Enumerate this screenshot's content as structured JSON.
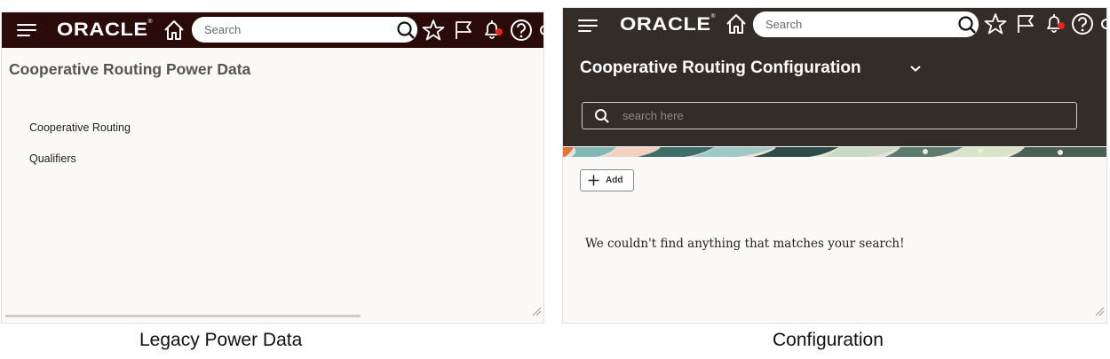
{
  "left_panel": {
    "topbar": {
      "logo_text": "ORACLE",
      "logo_mark": "®",
      "search_placeholder": "Search",
      "icons": [
        "hamburger-menu-icon",
        "home-icon",
        "search-icon",
        "star-icon",
        "flag-icon",
        "bell-icon",
        "help-icon"
      ]
    },
    "page_title": "Cooperative Routing Power Data",
    "nav_items": [
      {
        "label": "Cooperative Routing"
      },
      {
        "label": "Qualifiers"
      }
    ]
  },
  "right_panel": {
    "topbar": {
      "logo_text": "ORACLE",
      "logo_mark": "®",
      "search_placeholder": "Search",
      "icons": [
        "hamburger-menu-icon",
        "home-icon",
        "search-icon",
        "star-icon",
        "flag-icon",
        "bell-icon",
        "help-icon"
      ]
    },
    "page_title": "Cooperative Routing Configuration",
    "search_placeholder": "search here",
    "add_button_label": "Add",
    "empty_message": "We couldn't find anything that matches your search!"
  },
  "captions": {
    "left": "Legacy Power Data",
    "right": "Configuration"
  },
  "colors": {
    "left_topbar": "#2b0a0a",
    "right_header": "#332d2a",
    "notification_dot": "#e0271a",
    "panel_background": "#faf9f8"
  }
}
